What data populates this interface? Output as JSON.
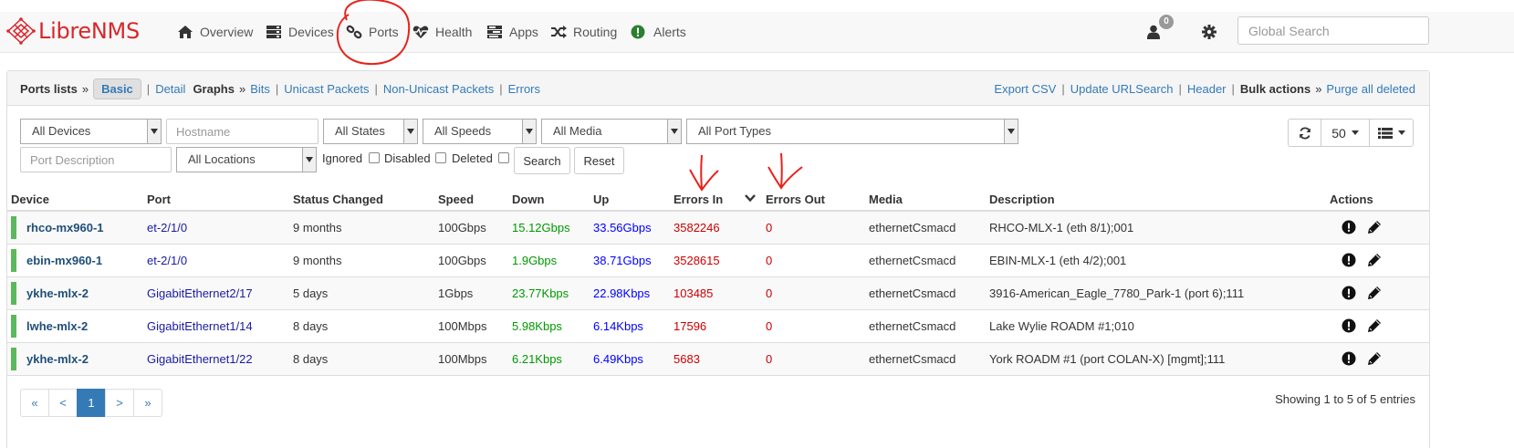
{
  "brand": {
    "name_part1": "Libre",
    "name_part2": "NMS"
  },
  "nav": {
    "items": [
      {
        "label": "Overview",
        "icon": "home-icon"
      },
      {
        "label": "Devices",
        "icon": "server-icon"
      },
      {
        "label": "Ports",
        "icon": "link-icon"
      },
      {
        "label": "Health",
        "icon": "heartbeat-icon"
      },
      {
        "label": "Apps",
        "icon": "tasks-icon"
      },
      {
        "label": "Routing",
        "icon": "random-icon"
      },
      {
        "label": "Alerts",
        "icon": "exclamation-circle-icon"
      }
    ],
    "user_badge": "0",
    "search_placeholder": "Global Search"
  },
  "panel_heading": {
    "ports_lists": "Ports lists",
    "basic": "Basic",
    "detail": "Detail",
    "graphs": "Graphs",
    "bits": "Bits",
    "unicast": "Unicast Packets",
    "nonunicast": "Non-Unicast Packets",
    "errors": "Errors",
    "export_csv": "Export CSV",
    "update_url": "Update URLSearch",
    "header": "Header",
    "bulk_actions": "Bulk actions",
    "purge": "Purge all deleted"
  },
  "filters": {
    "devices": "All Devices",
    "hostname_placeholder": "Hostname",
    "states": "All States",
    "speeds": "All Speeds",
    "media": "All Media",
    "port_types": "All Port Types",
    "port_desc_placeholder": "Port Description",
    "locations": "All Locations",
    "ignored": "Ignored",
    "disabled": "Disabled",
    "deleted": "Deleted",
    "search": "Search",
    "reset": "Reset",
    "page_size": "50"
  },
  "table": {
    "headers": [
      "Device",
      "Port",
      "Status Changed",
      "Speed",
      "Down",
      "Up",
      "Errors In",
      "Errors Out",
      "Media",
      "Description",
      "Actions"
    ],
    "rows": [
      {
        "device": "rhco-mx960-1",
        "port": "et-2/1/0",
        "status": "9 months",
        "speed": "100Gbps",
        "down": "15.12Gbps",
        "up": "33.56Gbps",
        "errin": "3582246",
        "errout": "0",
        "media": "ethernetCsmacd",
        "desc": "RHCO-MLX-1 (eth 8/1);001"
      },
      {
        "device": "ebin-mx960-1",
        "port": "et-2/1/0",
        "status": "9 months",
        "speed": "100Gbps",
        "down": "1.9Gbps",
        "up": "38.71Gbps",
        "errin": "3528615",
        "errout": "0",
        "media": "ethernetCsmacd",
        "desc": "EBIN-MLX-1 (eth 4/2);001"
      },
      {
        "device": "ykhe-mlx-2",
        "port": "GigabitEthernet2/17",
        "status": "5 days",
        "speed": "1Gbps",
        "down": "23.77Kbps",
        "up": "22.98Kbps",
        "errin": "103485",
        "errout": "0",
        "media": "ethernetCsmacd",
        "desc": "3916-American_Eagle_7780_Park-1 (port 6);111"
      },
      {
        "device": "lwhe-mlx-2",
        "port": "GigabitEthernet1/14",
        "status": "8 days",
        "speed": "100Mbps",
        "down": "5.98Kbps",
        "up": "6.14Kbps",
        "errin": "17596",
        "errout": "0",
        "media": "ethernetCsmacd",
        "desc": "Lake Wylie ROADM #1;010"
      },
      {
        "device": "ykhe-mlx-2",
        "port": "GigabitEthernet1/22",
        "status": "8 days",
        "speed": "100Mbps",
        "down": "6.21Kbps",
        "up": "6.49Kbps",
        "errin": "5683",
        "errout": "0",
        "media": "ethernetCsmacd",
        "desc": "York ROADM #1 (port COLAN-X) [mgmt];111"
      }
    ]
  },
  "pagination": {
    "first": "«",
    "prev": "<",
    "current": "1",
    "next": ">",
    "last": "»",
    "showing": "Showing 1 to 5 of 5 entries"
  },
  "colors": {
    "brand_red": "#d9262b",
    "link_blue": "#337ab7",
    "status_up_green": "#5cb85c",
    "error_red": "#cc0000",
    "annotation_red": "#e8211b"
  }
}
